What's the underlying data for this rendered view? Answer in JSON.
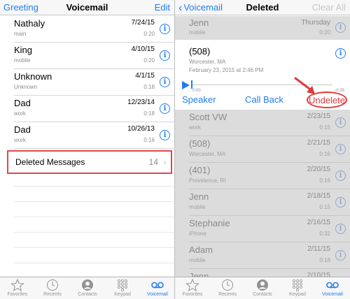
{
  "left": {
    "nav": {
      "left": "Greeting",
      "title": "Voicemail",
      "right": "Edit"
    },
    "voicemails": [
      {
        "name": "Nathaly",
        "label": "main",
        "date": "7/24/15",
        "duration": "0:20"
      },
      {
        "name": "King",
        "label": "mobile",
        "date": "4/10/15",
        "duration": "0:20"
      },
      {
        "name": "Unknown",
        "label": "Unknown",
        "date": "4/1/15",
        "duration": "0:18"
      },
      {
        "name": "Dad",
        "label": "work",
        "date": "12/23/14",
        "duration": "0:18"
      },
      {
        "name": "Dad",
        "label": "work",
        "date": "10/26/13",
        "duration": "0:16"
      }
    ],
    "deleted": {
      "label": "Deleted Messages",
      "count": "14"
    }
  },
  "right": {
    "nav": {
      "back": "Voicemail",
      "title": "Deleted",
      "right": "Clear All"
    },
    "top_row": {
      "name": "Jenn",
      "label": "mobile",
      "date": "Thursday",
      "duration": "0:20"
    },
    "expanded": {
      "name": "(508)",
      "location": "Worcester, MA",
      "datetime": "February 23, 2015 at 2:46 PM",
      "time_start": "0:00",
      "time_end": "-0:35",
      "speaker": "Speaker",
      "call_back": "Call Back",
      "undelete": "Undelete"
    },
    "rows": [
      {
        "name": "Scott VW",
        "label": "work",
        "date": "2/23/15",
        "duration": "0:15"
      },
      {
        "name": "(508)",
        "label": "Worcester, MA",
        "date": "2/21/15",
        "duration": "0:16"
      },
      {
        "name": "(401)",
        "label": "Providence, RI",
        "date": "2/20/15",
        "duration": "0:16"
      },
      {
        "name": "Jenn",
        "label": "mobile",
        "date": "2/18/15",
        "duration": "0:15"
      },
      {
        "name": "Stephanie",
        "label": "iPhone",
        "date": "2/16/15",
        "duration": "0:32"
      },
      {
        "name": "Adam",
        "label": "mobile",
        "date": "2/11/15",
        "duration": "0:18"
      },
      {
        "name": "Jenn",
        "label": "",
        "date": "2/10/15",
        "duration": ""
      }
    ]
  },
  "tabbar": [
    {
      "label": "Favorites",
      "icon": "star-icon"
    },
    {
      "label": "Recents",
      "icon": "clock-icon"
    },
    {
      "label": "Contacts",
      "icon": "contact-icon"
    },
    {
      "label": "Keypad",
      "icon": "keypad-icon"
    },
    {
      "label": "Voicemail",
      "icon": "voicemail-icon",
      "active": true
    }
  ],
  "colors": {
    "accent": "#1f7cf2",
    "highlight": "#e03a3a"
  }
}
